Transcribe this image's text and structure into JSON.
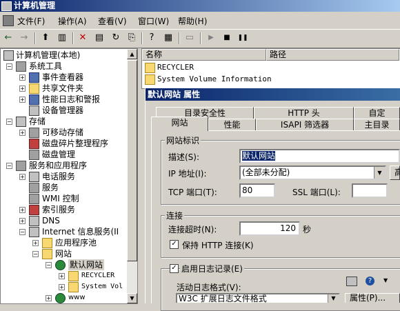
{
  "window": {
    "title": "计算机管理"
  },
  "menu": {
    "items": [
      {
        "label": "文件(F)"
      },
      {
        "label": "操作(A)"
      },
      {
        "label": "查看(V)"
      },
      {
        "label": "窗口(W)"
      },
      {
        "label": "帮助(H)"
      }
    ]
  },
  "toolbar": {
    "back": "←",
    "forward": "→",
    "up": "⬆",
    "tree_toggle": "▥",
    "delete": "✕",
    "properties": "▤",
    "refresh": "↻",
    "export": "⎘",
    "help": "?",
    "view": "▦",
    "computer": "▭",
    "play": "▶",
    "stop": "■",
    "pause": "❚❚"
  },
  "tree": {
    "items": [
      {
        "label": "计算机管理(本地)"
      },
      {
        "label": "系统工具"
      },
      {
        "label": "事件查看器"
      },
      {
        "label": "共享文件夹"
      },
      {
        "label": "性能日志和警报"
      },
      {
        "label": "设备管理器"
      },
      {
        "label": "存储"
      },
      {
        "label": "可移动存储"
      },
      {
        "label": "磁盘碎片整理程序"
      },
      {
        "label": "磁盘管理"
      },
      {
        "label": "服务和应用程序"
      },
      {
        "label": "电话服务"
      },
      {
        "label": "服务"
      },
      {
        "label": "WMI 控制"
      },
      {
        "label": "索引服务"
      },
      {
        "label": "DNS"
      },
      {
        "label": "Internet 信息服务(II"
      },
      {
        "label": "应用程序池"
      },
      {
        "label": "网站"
      },
      {
        "label": "默认网站"
      },
      {
        "label": "RECYCLER"
      },
      {
        "label": "System Vol"
      },
      {
        "label": "www"
      }
    ]
  },
  "list": {
    "columns": [
      "名称",
      "路径"
    ],
    "rows": [
      {
        "name": "RECYCLER"
      },
      {
        "name": "System Volume Information"
      }
    ]
  },
  "dialog": {
    "title": "默认网站 属性",
    "tabs_back": [
      "目录安全性",
      "HTTP 头",
      "自定"
    ],
    "tabs_front": [
      "网站",
      "性能",
      "ISAPI 筛选器",
      "主目录"
    ],
    "site_group": "网站标识",
    "desc_label": "描述(S):",
    "desc_value": "默认网站",
    "ip_label": "IP 地址(I):",
    "ip_value": "(全部未分配)",
    "adv_btn": "高",
    "tcp_label": "TCP 端口(T):",
    "tcp_value": "80",
    "ssl_label": "SSL 端口(L):",
    "ssl_value": "",
    "conn_group": "连接",
    "timeout_label": "连接超时(N):",
    "timeout_value": "120",
    "timeout_unit": "秒",
    "keepalive_label": "保持 HTTP 连接(K)",
    "logging_label": "启用日志记录(E)",
    "log_format_label": "活动日志格式(V):",
    "log_format_value": "W3C 扩展日志文件格式",
    "props_btn": "属性(P)..."
  }
}
